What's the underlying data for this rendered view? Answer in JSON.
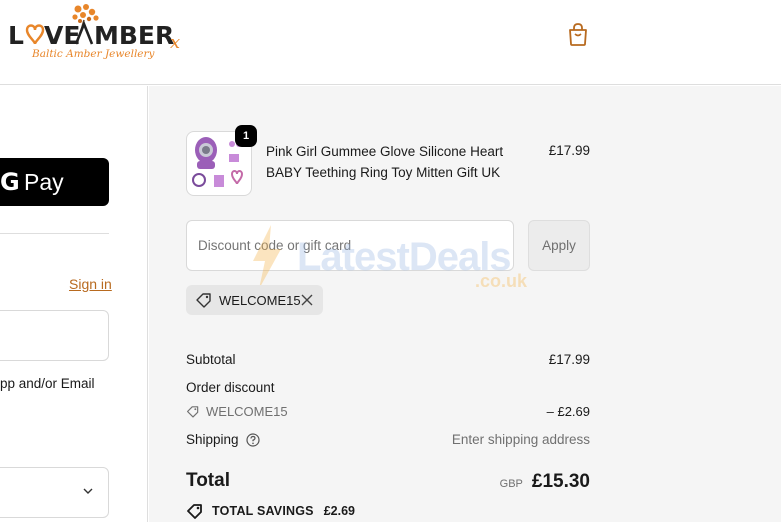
{
  "header": {
    "brand_name": "LOVE AMBER",
    "brand_tagline": "Baltic Amber Jewellery",
    "cart_icon": "shopping-bag-icon",
    "accent_color": "#b86a1f"
  },
  "left_panel": {
    "gpay_label": "Pay",
    "signin_label": "Sign in",
    "email_value": "",
    "consent_text": "pp and/or Email",
    "country_value": ""
  },
  "order": {
    "product": {
      "quantity": "1",
      "title": "Pink Girl Gummee Glove Silicone Heart BABY Teething Ring Toy Mitten Gift UK",
      "price": "£17.99"
    },
    "discount_field": {
      "placeholder": "Discount code or gift card",
      "value": ""
    },
    "apply_label": "Apply",
    "applied_code": "WELCOME15",
    "watermark": {
      "text": "LatestDeals",
      "suffix": ".co.uk"
    },
    "summary": {
      "subtotal_label": "Subtotal",
      "subtotal_value": "£17.99",
      "order_discount_label": "Order discount",
      "discount_code": "WELCOME15",
      "discount_value": "– £2.69",
      "shipping_label": "Shipping",
      "shipping_value": "Enter shipping address",
      "total_label": "Total",
      "currency": "GBP",
      "total_value": "£15.30",
      "savings_label": "TOTAL SAVINGS",
      "savings_value": "£2.69"
    }
  }
}
